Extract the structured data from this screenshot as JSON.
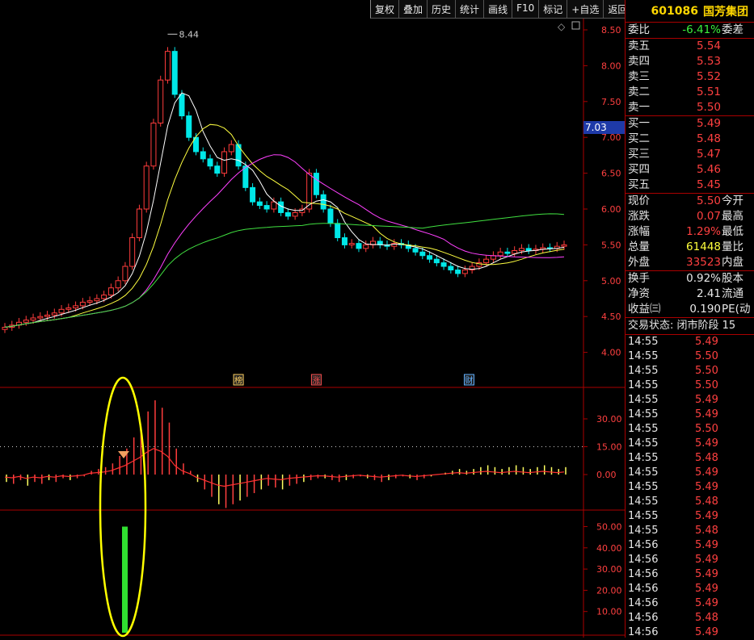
{
  "toolbar": [
    "复权",
    "叠加",
    "历史",
    "统计",
    "画线",
    "F10",
    "标记",
    "+自选",
    "返回"
  ],
  "stock": {
    "code": "601086",
    "name": "国芳集团"
  },
  "colors": {
    "up": "#ff3c3c",
    "down": "#00e8e8",
    "ma5": "#ffffff",
    "ma10": "#ffff40",
    "ma20": "#ff40ff",
    "ma60": "#40e040",
    "accent_red": "#aa0000"
  },
  "main_chart": {
    "price_labels": [
      "8.50",
      "8.00",
      "7.50",
      "7.00",
      "6.50",
      "6.00",
      "5.50",
      "5.00",
      "4.50",
      "4.00"
    ],
    "high_label": "8.44",
    "current_price_tag": "7.03",
    "markers": [
      {
        "text": "榜",
        "color": "#ffd060"
      },
      {
        "text": "涨",
        "color": "#ff5050"
      },
      {
        "text": "财",
        "color": "#60b0ff"
      }
    ]
  },
  "indicator1": {
    "labels": [
      "30.00",
      "15.00",
      "0.00"
    ]
  },
  "indicator2": {
    "labels": [
      "50.00",
      "40.00",
      "30.00",
      "20.00",
      "10.00"
    ]
  },
  "quote": {
    "weibi": {
      "label": "委比",
      "value": "-6.41%",
      "label2": "委差"
    },
    "sells": [
      {
        "label": "卖五",
        "price": "5.54"
      },
      {
        "label": "卖四",
        "price": "5.53"
      },
      {
        "label": "卖三",
        "price": "5.52"
      },
      {
        "label": "卖二",
        "price": "5.51"
      },
      {
        "label": "卖一",
        "price": "5.50"
      }
    ],
    "buys": [
      {
        "label": "买一",
        "price": "5.49"
      },
      {
        "label": "买二",
        "price": "5.48"
      },
      {
        "label": "买三",
        "price": "5.47"
      },
      {
        "label": "买四",
        "price": "5.46"
      },
      {
        "label": "买五",
        "price": "5.45"
      }
    ],
    "stats": [
      {
        "label": "现价",
        "value": "5.50",
        "label2": "今开",
        "cls": "red"
      },
      {
        "label": "涨跌",
        "value": "0.07",
        "label2": "最高",
        "cls": "red"
      },
      {
        "label": "涨幅",
        "value": "1.29%",
        "label2": "最低",
        "cls": "red"
      },
      {
        "label": "总量",
        "value": "61448",
        "label2": "量比",
        "cls": "yellow"
      },
      {
        "label": "外盘",
        "value": "33523",
        "label2": "内盘",
        "cls": "red"
      }
    ],
    "stats2": [
      {
        "label": "换手",
        "value": "0.92%",
        "label2": "股本",
        "cls": "white"
      },
      {
        "label": "净资",
        "value": "2.41",
        "label2": "流通",
        "cls": "white"
      },
      {
        "label": "收益㈢",
        "value": "0.190",
        "label2": "PE(动",
        "cls": "white"
      }
    ],
    "status": "交易状态: 闭市阶段 15"
  },
  "ticks": [
    {
      "time": "14:55",
      "price": "5.49"
    },
    {
      "time": "14:55",
      "price": "5.50"
    },
    {
      "time": "14:55",
      "price": "5.50"
    },
    {
      "time": "14:55",
      "price": "5.50"
    },
    {
      "time": "14:55",
      "price": "5.49"
    },
    {
      "time": "14:55",
      "price": "5.49"
    },
    {
      "time": "14:55",
      "price": "5.50"
    },
    {
      "time": "14:55",
      "price": "5.49"
    },
    {
      "time": "14:55",
      "price": "5.48"
    },
    {
      "time": "14:55",
      "price": "5.49"
    },
    {
      "time": "14:55",
      "price": "5.49"
    },
    {
      "time": "14:55",
      "price": "5.48"
    },
    {
      "time": "14:55",
      "price": "5.49"
    },
    {
      "time": "14:55",
      "price": "5.48"
    },
    {
      "time": "14:56",
      "price": "5.49"
    },
    {
      "time": "14:56",
      "price": "5.49"
    },
    {
      "time": "14:56",
      "price": "5.49"
    },
    {
      "time": "14:56",
      "price": "5.49"
    },
    {
      "time": "14:56",
      "price": "5.49"
    },
    {
      "time": "14:56",
      "price": "5.48"
    },
    {
      "time": "14:56",
      "price": "5.49"
    }
  ]
}
